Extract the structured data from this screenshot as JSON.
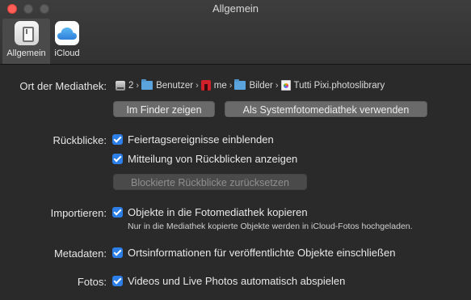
{
  "window": {
    "title": "Allgemein"
  },
  "toolbar": {
    "tabs": [
      {
        "label": "Allgemein",
        "icon": "general-switch-icon",
        "selected": true
      },
      {
        "label": "iCloud",
        "icon": "icloud-icon",
        "selected": false
      }
    ]
  },
  "library": {
    "label": "Ort der Mediathek:",
    "path": [
      {
        "text": "2",
        "icon": "disk-icon"
      },
      {
        "text": "Benutzer",
        "icon": "folder-icon"
      },
      {
        "text": "me",
        "icon": "home-icon"
      },
      {
        "text": "Bilder",
        "icon": "folder-icon"
      },
      {
        "text": "Tutti Pixi.photoslibrary",
        "icon": "photos-library-icon"
      }
    ],
    "separator": "›",
    "buttons": {
      "show_in_finder": "Im Finder zeigen",
      "use_as_system": "Als Systemfotomediathek verwenden"
    }
  },
  "memories": {
    "label": "Rückblicke:",
    "options": [
      {
        "text": "Feiertagsereignisse einblenden",
        "checked": true
      },
      {
        "text": "Mitteilung von Rückblicken anzeigen",
        "checked": true
      }
    ],
    "reset_button": "Blockierte Rückblicke zurücksetzen"
  },
  "importing": {
    "label": "Importieren:",
    "option": {
      "text": "Objekte in die Fotomediathek kopieren",
      "checked": true
    },
    "note": "Nur in die Mediathek kopierte Objekte werden in iCloud-Fotos hochgeladen."
  },
  "metadata": {
    "label": "Metadaten:",
    "option": {
      "text": "Ortsinformationen für veröffentlichte Objekte einschließen",
      "checked": true
    }
  },
  "photos": {
    "label": "Fotos:",
    "option": {
      "text": "Videos und Live Photos automatisch abspielen",
      "checked": true
    }
  },
  "colors": {
    "accent": "#2d7fe8",
    "window_bg": "#2a2a2a",
    "toolbar_bg": "#363636",
    "folder": "#5aa3dc",
    "home": "#d0212a"
  }
}
